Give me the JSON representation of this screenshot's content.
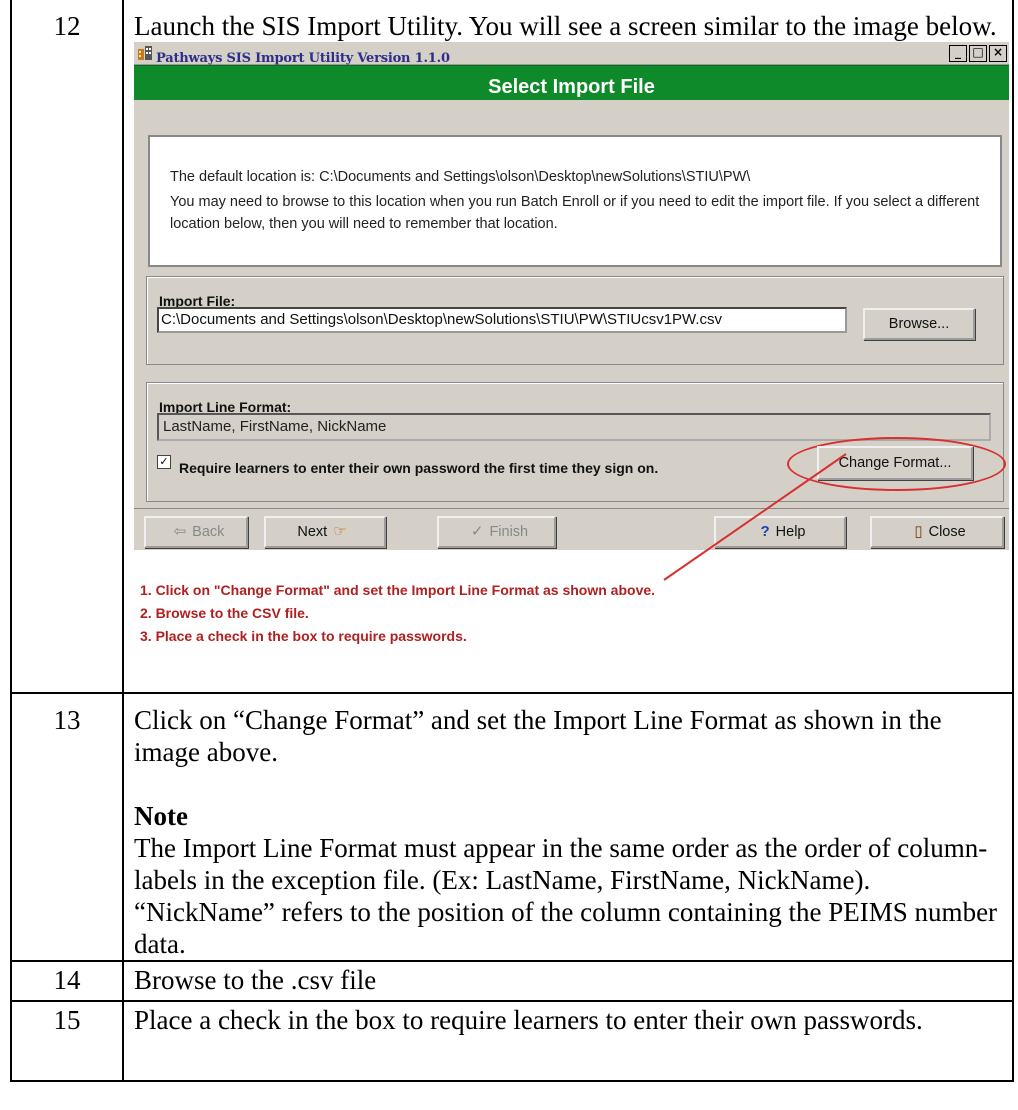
{
  "rows": [
    {
      "num": "12",
      "text": "Launch the SIS Import Utility. You will see a screen similar to the image below."
    },
    {
      "num": "13",
      "text": "Click on “Change Format” and set the Import Line Format as shown in the image above.",
      "note_title": "Note",
      "note_text": "The Import Line Format must appear in the same order as the order of column-labels in the exception file. (Ex: LastName, FirstName, NickName). “NickName” refers to the position of the column containing the PEIMS number data."
    },
    {
      "num": "14",
      "text": "Browse to the .csv file"
    },
    {
      "num": "15",
      "text": "Place a check in the box to require learners to enter their own passwords."
    }
  ],
  "screenshot": {
    "window_title": "Pathways SIS Import Utility Version 1.1.0",
    "window_controls": {
      "minimize": "_",
      "maximize": "□",
      "close": "×"
    },
    "header": "Select Import File",
    "info_line1": "The default location is:  C:\\Documents and Settings\\olson\\Desktop\\newSolutions\\STIU\\PW\\",
    "info_line2": "You may need to browse to this location when you run Batch Enroll or if you need to edit the import file.  If you select a different location below, then you will need to remember that location.",
    "import_file_label": "Import File:",
    "import_file_value": "C:\\Documents and Settings\\olson\\Desktop\\newSolutions\\STIU\\PW\\STIUcsv1PW.csv",
    "browse_button": "Browse...",
    "import_line_format_label": "Import Line Format:",
    "import_line_format_value": "LastName, FirstName, NickName",
    "require_password_checked": true,
    "require_password_label": "Require learners to enter their own password the first time they sign on.",
    "change_format_button": "Change Format...",
    "nav": {
      "back": "Back",
      "next": "Next",
      "finish": "Finish",
      "help": "Help",
      "close": "Close"
    },
    "annotations": [
      "1. Click on \"Change Format\" and set the Import Line Format as shown above.",
      "2. Browse to the CSV file.",
      "3. Place a check in the box to require passwords."
    ],
    "colors": {
      "title_bar_green": "#0f8a2a",
      "annotation_red": "#b02020",
      "dialog_gray": "#d4d0c8"
    }
  }
}
